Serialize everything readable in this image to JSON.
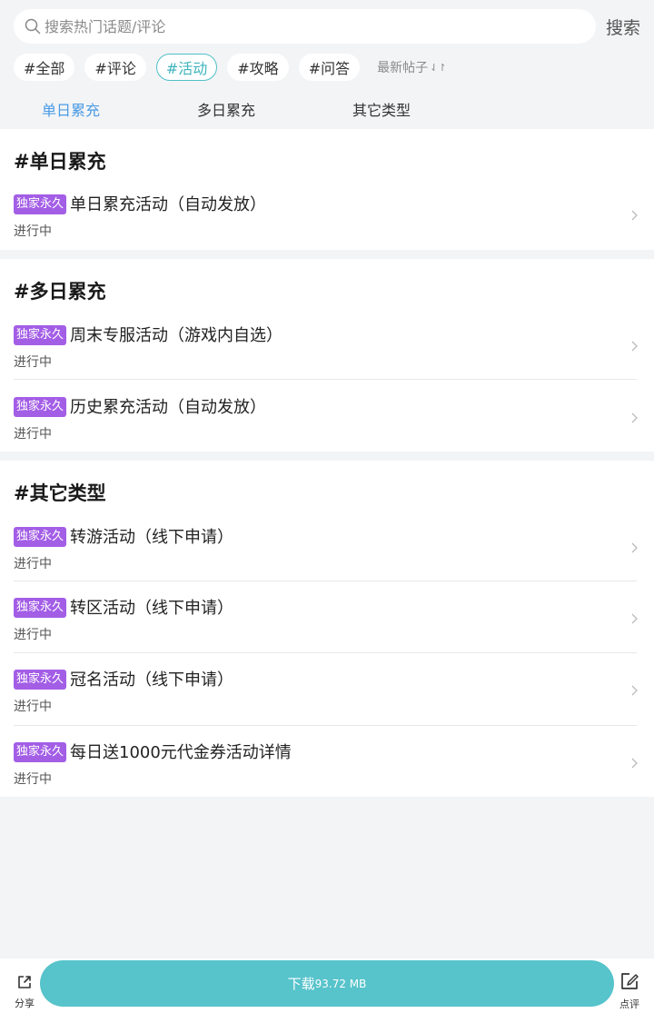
{
  "search": {
    "placeholder": "搜索热门话题/评论",
    "button": "搜索"
  },
  "tags": [
    "#全部",
    "#评论",
    "#活动",
    "#攻略",
    "#问答"
  ],
  "active_tag": "#活动",
  "sort": {
    "label": "最新帖子",
    "icon": "sort-icon"
  },
  "subtabs": [
    "单日累充",
    "多日累充",
    "其它类型"
  ],
  "active_subtab": "单日累充",
  "sections": [
    {
      "title": "#单日累充",
      "items": [
        {
          "badge": "独家永久",
          "title": "单日累充活动（自动发放）",
          "status": "进行中"
        }
      ]
    },
    {
      "title": "#多日累充",
      "items": [
        {
          "badge": "独家永久",
          "title": "周末专服活动（游戏内自选）",
          "status": "进行中"
        },
        {
          "badge": "独家永久",
          "title": "历史累充活动（自动发放）",
          "status": "进行中"
        }
      ]
    },
    {
      "title": "#其它类型",
      "items": [
        {
          "badge": "独家永久",
          "title": "转游活动（线下申请）",
          "status": "进行中"
        },
        {
          "badge": "独家永久",
          "title": "转区活动（线下申请）",
          "status": "进行中"
        },
        {
          "badge": "独家永久",
          "title": "冠名活动（线下申请）",
          "status": "进行中"
        },
        {
          "badge": "独家永久",
          "title": "每日送1000元代金券活动详情",
          "status": "进行中"
        }
      ]
    }
  ],
  "bottom": {
    "share_label": "分享",
    "download_label": "下载",
    "download_size": "93.72 MB",
    "review_label": "点评"
  },
  "colors": {
    "accent": "#57c3cb",
    "badge": "#a35ee6",
    "active_subtab": "#4a9be5"
  }
}
